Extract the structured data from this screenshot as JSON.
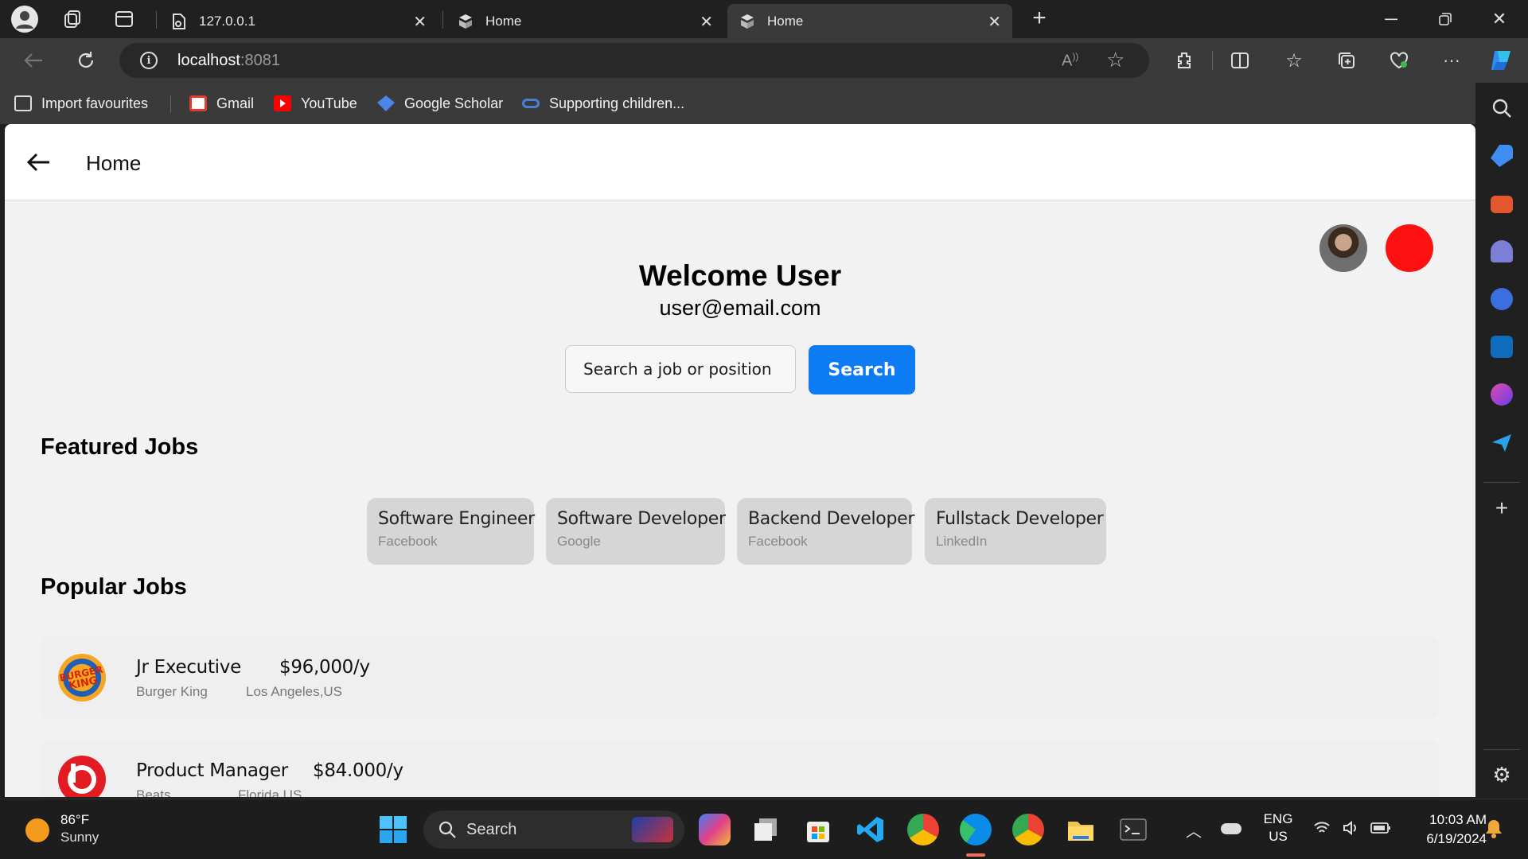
{
  "browser": {
    "tabs": [
      {
        "label": "127.0.0.1",
        "active": false
      },
      {
        "label": "Home",
        "active": false
      },
      {
        "label": "Home",
        "active": true
      }
    ],
    "address": {
      "host": "localhost",
      "port": ":8081"
    },
    "favourites": [
      {
        "label": "Import favourites",
        "icon": "import-icon"
      },
      {
        "label": "Gmail",
        "icon": "gmail-icon"
      },
      {
        "label": "YouTube",
        "icon": "youtube-icon"
      },
      {
        "label": "Google Scholar",
        "icon": "scholar-icon"
      },
      {
        "label": "Supporting children...",
        "icon": "link-icon"
      }
    ]
  },
  "app": {
    "header_title": "Home",
    "welcome": "Welcome User",
    "email": "user@email.com",
    "search": {
      "placeholder": "Search a job or position",
      "button": "Search"
    },
    "featured_title": "Featured Jobs",
    "featured": [
      {
        "title": "Software Engineer",
        "company": "Facebook"
      },
      {
        "title": "Software Developer",
        "company": "Google"
      },
      {
        "title": "Backend Developer",
        "company": "Facebook"
      },
      {
        "title": "Fullstack Developer",
        "company": "LinkedIn"
      }
    ],
    "popular_title": "Popular Jobs",
    "popular": [
      {
        "title": "Jr Executive",
        "salary": "$96,000/y",
        "company": "Burger King",
        "location": "Los Angeles,US",
        "logo": "burger-king-logo"
      },
      {
        "title": "Product Manager",
        "salary": "$84.000/y",
        "company": "Beats",
        "location": "Florida,US",
        "logo": "beats-logo"
      }
    ]
  },
  "taskbar": {
    "weather": {
      "temp": "86°F",
      "condition": "Sunny"
    },
    "search_label": "Search",
    "lang": {
      "line1": "ENG",
      "line2": "US"
    },
    "clock": {
      "time": "10:03 AM",
      "date": "6/19/2024"
    }
  },
  "colors": {
    "accent": "#0d7cf2",
    "status_dot": "#ff1010",
    "card": "#d6d6d6"
  }
}
